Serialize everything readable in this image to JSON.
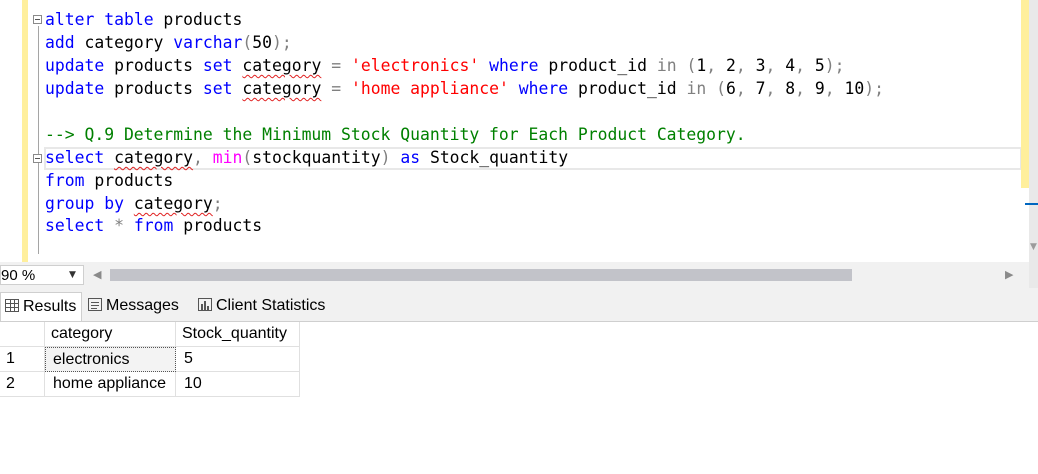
{
  "editor": {
    "lines": [
      [
        {
          "t": "alter",
          "c": "kw"
        },
        {
          "t": " "
        },
        {
          "t": "table",
          "c": "kw"
        },
        {
          "t": " products"
        }
      ],
      [
        {
          "t": "add",
          "c": "kw"
        },
        {
          "t": " category "
        },
        {
          "t": "varchar",
          "c": "kw"
        },
        {
          "t": "(",
          "c": "op"
        },
        {
          "t": "50"
        },
        {
          "t": ");",
          "c": "op"
        }
      ],
      [
        {
          "t": "update",
          "c": "kw"
        },
        {
          "t": " products "
        },
        {
          "t": "set",
          "c": "kw"
        },
        {
          "t": " "
        },
        {
          "t": "category",
          "c": "sq"
        },
        {
          "t": " "
        },
        {
          "t": "=",
          "c": "op"
        },
        {
          "t": " "
        },
        {
          "t": "'electronics'",
          "c": "str"
        },
        {
          "t": " "
        },
        {
          "t": "where",
          "c": "kw"
        },
        {
          "t": " product_id "
        },
        {
          "t": "in",
          "c": "op"
        },
        {
          "t": " "
        },
        {
          "t": "(",
          "c": "op"
        },
        {
          "t": "1"
        },
        {
          "t": ",",
          "c": "op"
        },
        {
          "t": " 2"
        },
        {
          "t": ",",
          "c": "op"
        },
        {
          "t": " 3"
        },
        {
          "t": ",",
          "c": "op"
        },
        {
          "t": " 4"
        },
        {
          "t": ",",
          "c": "op"
        },
        {
          "t": " 5"
        },
        {
          "t": ");",
          "c": "op"
        }
      ],
      [
        {
          "t": "update",
          "c": "kw"
        },
        {
          "t": " products "
        },
        {
          "t": "set",
          "c": "kw"
        },
        {
          "t": " "
        },
        {
          "t": "category",
          "c": "sq"
        },
        {
          "t": " "
        },
        {
          "t": "=",
          "c": "op"
        },
        {
          "t": " "
        },
        {
          "t": "'home appliance'",
          "c": "str"
        },
        {
          "t": " "
        },
        {
          "t": "where",
          "c": "kw"
        },
        {
          "t": " product_id "
        },
        {
          "t": "in",
          "c": "op"
        },
        {
          "t": " "
        },
        {
          "t": "(",
          "c": "op"
        },
        {
          "t": "6"
        },
        {
          "t": ",",
          "c": "op"
        },
        {
          "t": " 7"
        },
        {
          "t": ",",
          "c": "op"
        },
        {
          "t": " 8"
        },
        {
          "t": ",",
          "c": "op"
        },
        {
          "t": " 9"
        },
        {
          "t": ",",
          "c": "op"
        },
        {
          "t": " 10"
        },
        {
          "t": ");",
          "c": "op"
        }
      ],
      [],
      [
        {
          "t": "--> Q.9 Determine the Minimum Stock Quantity for Each Product Category.",
          "c": "cmt"
        }
      ],
      [
        {
          "t": "select",
          "c": "kw"
        },
        {
          "t": " "
        },
        {
          "t": "category",
          "c": "sq"
        },
        {
          "t": ",",
          "c": "op"
        },
        {
          "t": " "
        },
        {
          "t": "min",
          "c": "fn"
        },
        {
          "t": "(",
          "c": "op"
        },
        {
          "t": "stockquantity"
        },
        {
          "t": ")",
          "c": "op"
        },
        {
          "t": " "
        },
        {
          "t": "as",
          "c": "kw"
        },
        {
          "t": " Stock_quantity"
        }
      ],
      [
        {
          "t": "from",
          "c": "kw"
        },
        {
          "t": " products"
        }
      ],
      [
        {
          "t": "group",
          "c": "kw"
        },
        {
          "t": " "
        },
        {
          "t": "by",
          "c": "kw"
        },
        {
          "t": " "
        },
        {
          "t": "category",
          "c": "sq"
        },
        {
          "t": ";",
          "c": "op"
        }
      ],
      [
        {
          "t": "select",
          "c": "kw"
        },
        {
          "t": " "
        },
        {
          "t": "*",
          "c": "op"
        },
        {
          "t": " "
        },
        {
          "t": "from",
          "c": "kw"
        },
        {
          "t": " products"
        }
      ]
    ]
  },
  "status": {
    "zoom": "90 %"
  },
  "tabs": {
    "results": "Results",
    "messages": "Messages",
    "client_stats": "Client Statistics"
  },
  "grid": {
    "columns": [
      "category",
      "Stock_quantity"
    ],
    "rows": [
      {
        "num": "1",
        "category": "electronics",
        "stock": "5"
      },
      {
        "num": "2",
        "category": "home appliance",
        "stock": "10"
      }
    ]
  },
  "colors": {
    "keyword": "#0000ff",
    "function": "#ff00ff",
    "string": "#ff0000",
    "operator": "#808080",
    "comment": "#008000",
    "margin_yellow": "#ffef9c"
  },
  "icons": {
    "results_tab": "grid-icon",
    "messages_tab": "messages-icon",
    "client_stats_tab": "statistics-icon"
  }
}
